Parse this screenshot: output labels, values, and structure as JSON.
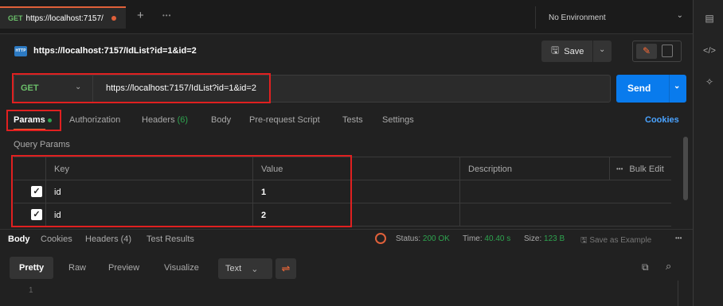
{
  "tabbar": {
    "tab_method": "GET",
    "tab_url": "https://localhost:7157/",
    "new_tab": "+",
    "more": "•••",
    "environment": "No Environment"
  },
  "request": {
    "icon_label": "HTTP",
    "name": "https://localhost:7157/IdList?id=1&id=2",
    "save_label": "Save",
    "method": "GET",
    "url": "https://localhost:7157/IdList?id=1&id=2",
    "send_label": "Send"
  },
  "request_tabs": {
    "params": "Params",
    "authorization": "Authorization",
    "headers": "Headers",
    "headers_count": "(6)",
    "body": "Body",
    "pre_request": "Pre-request Script",
    "tests": "Tests",
    "settings": "Settings",
    "cookies": "Cookies"
  },
  "query_params": {
    "title": "Query Params",
    "columns": {
      "key": "Key",
      "value": "Value",
      "description": "Description",
      "bulk_edit": "Bulk Edit",
      "more": "•••"
    },
    "rows": [
      {
        "key": "id",
        "value": "1",
        "description": ""
      },
      {
        "key": "id",
        "value": "2",
        "description": ""
      }
    ]
  },
  "response": {
    "tabs": {
      "body": "Body",
      "cookies": "Cookies",
      "headers": "Headers (4)",
      "test_results": "Test Results"
    },
    "status_label": "Status:",
    "status_value": "200 OK",
    "time_label": "Time:",
    "time_value": "40.40 s",
    "size_label": "Size:",
    "size_value": "123 B",
    "save_example": "Save as Example",
    "more": "•••"
  },
  "format": {
    "pretty": "Pretty",
    "raw": "Raw",
    "preview": "Preview",
    "visualize": "Visualize",
    "text": "Text",
    "line_1": "1"
  },
  "colors": {
    "accent": "#ff6c37",
    "send": "#097bed",
    "get_method": "#6bbf6a",
    "ok": "#2ea44f",
    "highlight": "#e02020"
  }
}
